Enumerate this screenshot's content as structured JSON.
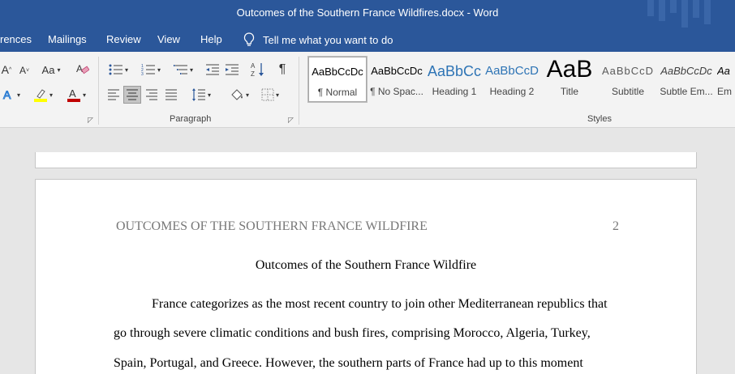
{
  "window": {
    "title": "Outcomes of the Southern France Wildfires.docx  -  Word"
  },
  "ribbon_tabs": {
    "references": "rences",
    "mailings": "Mailings",
    "review": "Review",
    "view": "View",
    "help": "Help",
    "tell_me": "Tell me what you want to do"
  },
  "font_group": {
    "grow": "A",
    "shrink": "A",
    "change_case": "Aa",
    "text_effects": "A",
    "font_color": "A",
    "font_color_value": "#c00000",
    "highlight_value": "#ffff00"
  },
  "paragraph_group": {
    "label": "Paragraph",
    "pilcrow": "¶"
  },
  "styles_group": {
    "label": "Styles",
    "items": [
      {
        "sample": "AaBbCcDc",
        "name": "¶ Normal"
      },
      {
        "sample": "AaBbCcDc",
        "name": "¶ No Spac..."
      },
      {
        "sample": "AaBbCc",
        "name": "Heading 1"
      },
      {
        "sample": "AaBbCcD",
        "name": "Heading 2"
      },
      {
        "sample": "AaB",
        "name": "Title"
      },
      {
        "sample": "AaBbCcD",
        "name": "Subtitle"
      },
      {
        "sample": "AaBbCcDc",
        "name": "Subtle Em..."
      },
      {
        "sample": "Aa",
        "name": "Em"
      }
    ]
  },
  "document": {
    "header_text": "OUTCOMES OF THE SOUTHERN FRANCE WILDFIRE",
    "page_number": "2",
    "title": "Outcomes of the Southern France Wildfire",
    "lines": [
      "France categorizes as the most recent country to join other Mediterranean republics that",
      "go through severe climatic conditions and bush fires, comprising Morocco, Algeria, Turkey,",
      "Spain, Portugal, and Greece. However, the southern parts of France had up to this moment"
    ]
  }
}
